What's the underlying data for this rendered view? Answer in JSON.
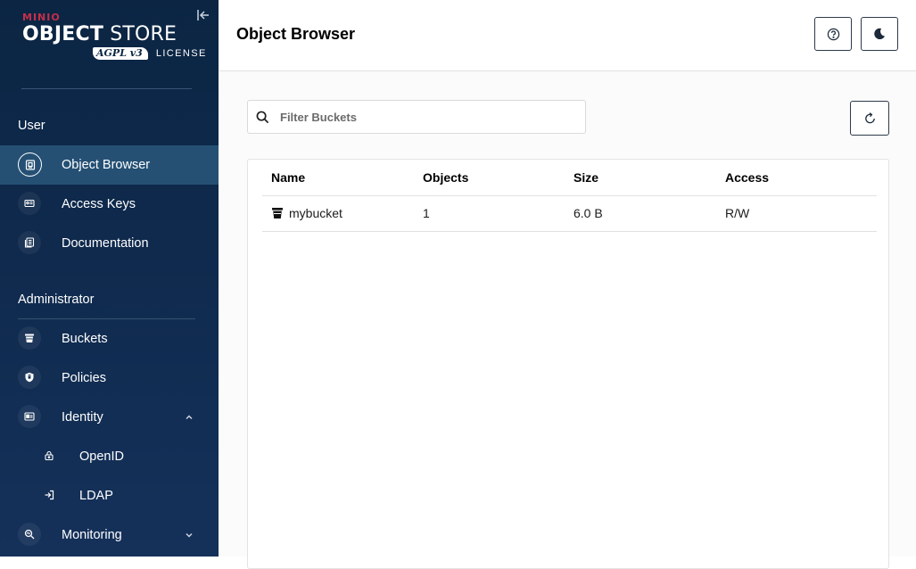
{
  "logo": {
    "brand": "MINIO",
    "product_bold": "OBJECT",
    "product_light": " STORE",
    "badge": "AGPL v3",
    "license": "LICENSE"
  },
  "sidebar": {
    "user_section": "User",
    "user_items": [
      {
        "label": "Object Browser",
        "icon": "object-browser-icon",
        "active": true
      },
      {
        "label": "Access Keys",
        "icon": "access-keys-icon"
      },
      {
        "label": "Documentation",
        "icon": "documentation-icon"
      }
    ],
    "admin_section": "Administrator",
    "admin_items": [
      {
        "label": "Buckets",
        "icon": "bucket-icon"
      },
      {
        "label": "Policies",
        "icon": "policies-icon"
      },
      {
        "label": "Identity",
        "icon": "identity-icon",
        "expanded": true
      },
      {
        "label": "OpenID",
        "icon": "openid-icon"
      },
      {
        "label": "LDAP",
        "icon": "ldap-icon"
      },
      {
        "label": "Monitoring",
        "icon": "monitoring-icon",
        "expanded": false
      }
    ]
  },
  "header": {
    "title": "Object Browser"
  },
  "filter": {
    "placeholder": "Filter Buckets",
    "value": ""
  },
  "table": {
    "columns": [
      "Name",
      "Objects",
      "Size",
      "Access"
    ],
    "rows": [
      {
        "name": "mybucket",
        "objects": "1",
        "size": "6.0 B",
        "access": "R/W"
      }
    ]
  },
  "colors": {
    "sidebar_bg": "#0f2a4d",
    "active_item": "#255074",
    "brand_red": "#c72e49"
  }
}
